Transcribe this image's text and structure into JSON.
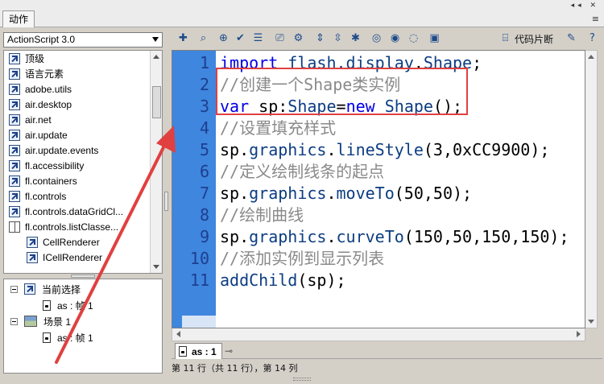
{
  "panel": {
    "tab_label": "动作",
    "header_buttons": "◂◂ ✕",
    "menu_icon": "≡"
  },
  "left": {
    "package_select": "ActionScript 3.0",
    "tree_items": [
      {
        "label": "顶级",
        "icon": "reference-icon"
      },
      {
        "label": "语言元素",
        "icon": "reference-icon"
      },
      {
        "label": "adobe.utils",
        "icon": "reference-icon"
      },
      {
        "label": "air.desktop",
        "icon": "reference-icon"
      },
      {
        "label": "air.net",
        "icon": "reference-icon"
      },
      {
        "label": "air.update",
        "icon": "reference-icon"
      },
      {
        "label": "air.update.events",
        "icon": "reference-icon"
      },
      {
        "label": "fl.accessibility",
        "icon": "reference-icon"
      },
      {
        "label": "fl.containers",
        "icon": "reference-icon"
      },
      {
        "label": "fl.controls",
        "icon": "reference-icon"
      },
      {
        "label": "fl.controls.dataGridCl...",
        "icon": "reference-icon"
      },
      {
        "label": "fl.controls.listClasse...",
        "icon": "book-icon"
      },
      {
        "label": "CellRenderer",
        "icon": "reference-icon",
        "sub": true
      },
      {
        "label": "ICellRenderer",
        "icon": "reference-icon",
        "sub": true
      }
    ],
    "scene_tree": {
      "current_selection": "当前选择",
      "current_frame": "as : 帧 1",
      "scene": "场景 1",
      "scene_frame": "as : 帧 1"
    }
  },
  "toolbar": {
    "code_snippets_label": "代码片断"
  },
  "editor": {
    "line_numbers": [
      "1",
      "2",
      "3",
      "4",
      "5",
      "6",
      "7",
      "8",
      "9",
      "10",
      "11"
    ],
    "code_lines": [
      "import flash.display.Shape;",
      "//创建一个Shape类实例",
      "var sp:Shape=new Shape();",
      "//设置填充样式",
      "sp.graphics.lineStyle(3,0xCC9900);",
      "//定义绘制线条的起点",
      "sp.graphics.moveTo(50,50);",
      "//绘制曲线",
      "sp.graphics.curveTo(150,50,150,150);",
      "//添加实例到显示列表",
      "addChild(sp);"
    ]
  },
  "script_tab": {
    "label": "as : 1"
  },
  "status": {
    "text": "第 11 行（共 11 行），第 14 列"
  },
  "colors": {
    "gutter_blue": "#3f86df",
    "keyword": "#0000e6",
    "comment": "#8a8a8a",
    "annotation_red": "#e04040"
  }
}
